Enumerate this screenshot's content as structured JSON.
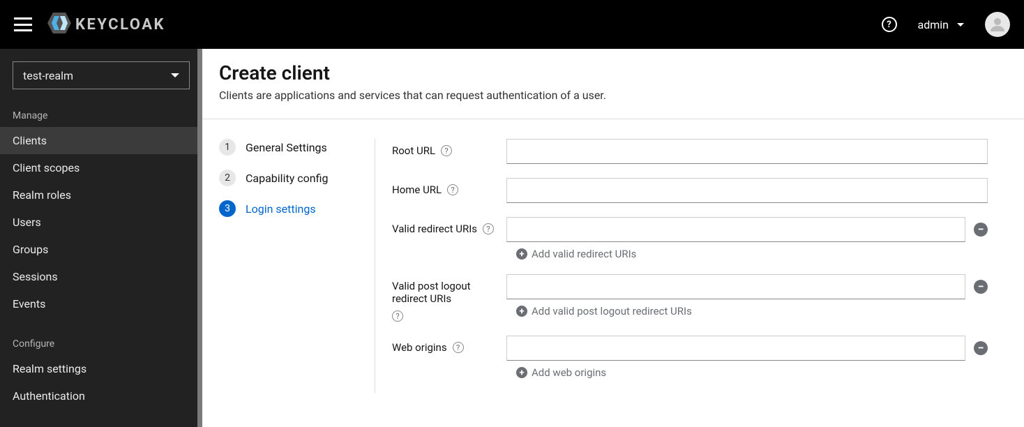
{
  "header": {
    "brand": "KEYCLOAK",
    "user": "admin"
  },
  "sidebar": {
    "realm": "test-realm",
    "sections": [
      {
        "title": "Manage",
        "items": [
          {
            "label": "Clients",
            "active": true
          },
          {
            "label": "Client scopes"
          },
          {
            "label": "Realm roles"
          },
          {
            "label": "Users"
          },
          {
            "label": "Groups"
          },
          {
            "label": "Sessions"
          },
          {
            "label": "Events"
          }
        ]
      },
      {
        "title": "Configure",
        "items": [
          {
            "label": "Realm settings"
          },
          {
            "label": "Authentication"
          }
        ]
      }
    ]
  },
  "page": {
    "title": "Create client",
    "subtitle": "Clients are applications and services that can request authentication of a user."
  },
  "wizard": {
    "steps": [
      {
        "num": "1",
        "label": "General Settings"
      },
      {
        "num": "2",
        "label": "Capability config"
      },
      {
        "num": "3",
        "label": "Login settings",
        "active": true
      }
    ]
  },
  "form": {
    "root_url": {
      "label": "Root URL",
      "value": ""
    },
    "home_url": {
      "label": "Home URL",
      "value": ""
    },
    "redirect": {
      "label": "Valid redirect URIs",
      "value": "",
      "add": "Add valid redirect URIs"
    },
    "post_logout": {
      "label": "Valid post logout redirect URIs",
      "value": "",
      "add": "Add valid post logout redirect URIs"
    },
    "web_origins": {
      "label": "Web origins",
      "value": "",
      "add": "Add web origins"
    }
  }
}
